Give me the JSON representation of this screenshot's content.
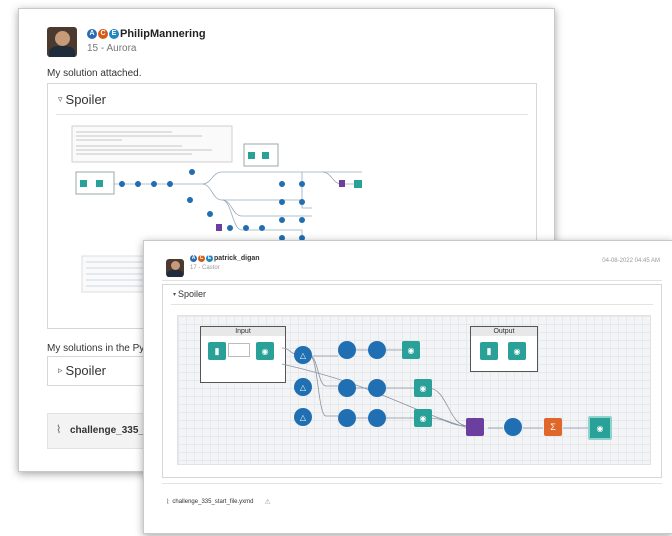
{
  "back_post": {
    "author": "PhilipMannering",
    "rank": "15 - Aurora",
    "badge": [
      "A",
      "C",
      "E"
    ],
    "intro": "My solution attached.",
    "spoiler1_label": "Spoiler",
    "python_text": "My solutions in the Pyt",
    "spoiler2_label": "Spoiler",
    "attachment": "challenge_335_s"
  },
  "front_post": {
    "author": "patrick_digan",
    "rank": "17 - Castor",
    "badge": [
      "A",
      "C",
      "E"
    ],
    "timestamp": "04-08-2022 04:45 AM",
    "spoiler_label": "Spoiler",
    "input_container": "Input",
    "output_container": "Output",
    "attachment": "challenge_335_start_file.yxmd"
  },
  "colors": {
    "accent_blue": "#1f6fb2",
    "teal": "#2aa198",
    "purple": "#6b3fa0",
    "orange": "#e0662a",
    "green": "#4caf50"
  },
  "icons": [
    "paperclip-icon",
    "chevron-down-icon",
    "chevron-right-icon",
    "book-icon",
    "binoculars-icon",
    "join-icon",
    "formula-icon",
    "summarize-icon",
    "warning-icon"
  ]
}
